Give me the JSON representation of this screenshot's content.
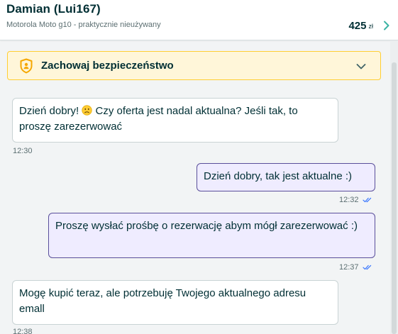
{
  "header": {
    "contact_name": "Damian (Lui167)",
    "ad_title": "Motorola Moto g10 - praktycznie nieużywany",
    "price_amount": "425",
    "price_currency": "zł"
  },
  "safety_banner": {
    "label": "Zachowaj bezpieczeństwo"
  },
  "messages": [
    {
      "direction": "incoming",
      "text_before_emoji": "Dzień dobry! ",
      "emoji": "slightly-frowning-face",
      "text_after_emoji": " Czy oferta jest nadal aktualna? Jeśli tak, to proszę zarezerwować",
      "time": "12:30"
    },
    {
      "direction": "outgoing",
      "text": "Dzień dobry, tak jest aktualne :)",
      "time": "12:32",
      "status": "read"
    },
    {
      "direction": "outgoing",
      "text": "Proszę wysłać prośbę o rezerwację abym mógł zarezerwować :)",
      "time": "12:37",
      "status": "read"
    },
    {
      "direction": "incoming",
      "text": "Mogę kupić teraz, ale potrzebuję Twojego aktualnego adresu emall",
      "time": "12:38"
    }
  ],
  "colors": {
    "brand_dark": "#002f34",
    "accent_teal": "#23e5db",
    "outgoing_bubble": "#efecff",
    "outgoing_border": "#5a4f9a",
    "safety_bg": "#fff6d9",
    "safety_border": "#ffce32",
    "read_ticks": "#3a77ff"
  },
  "icons": {
    "price_chevron": "chevron-right-icon",
    "safety": "shield-icon",
    "expand": "chevron-down-icon",
    "read_status": "double-check-icon"
  }
}
